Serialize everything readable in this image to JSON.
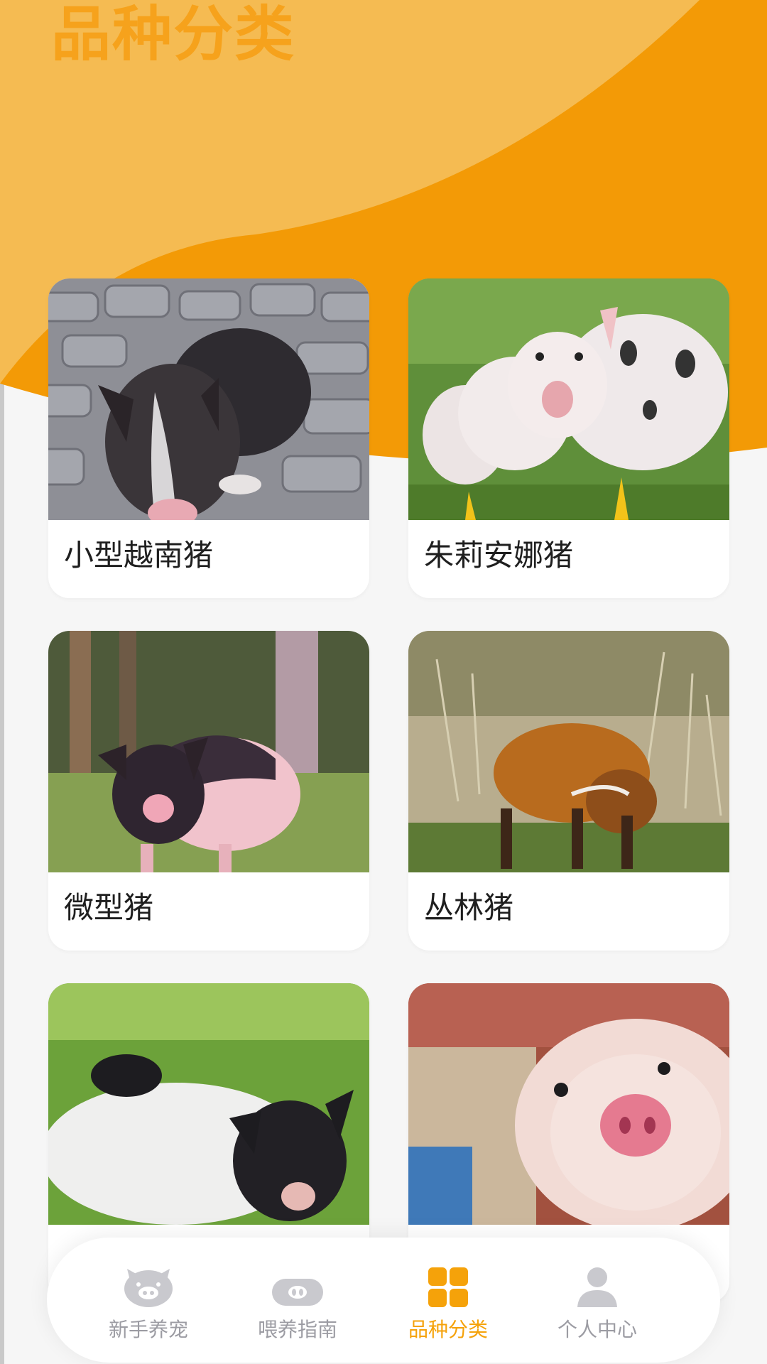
{
  "page": {
    "title": "品种分类"
  },
  "colors": {
    "header_orange": "#f39a06",
    "header_light": "#f5bb52",
    "title_color": "#f6a21c",
    "tab_active": "#f5a20a",
    "tab_inactive": "#9c9ca3",
    "background": "#f6f6f6"
  },
  "breeds": [
    {
      "name": "小型越南猪",
      "image": "black-potbelly-pig-photo"
    },
    {
      "name": "朱莉安娜猪",
      "image": "spotted-juliana-pigs-photo"
    },
    {
      "name": "微型猪",
      "image": "black-pink-micro-pig-photo"
    },
    {
      "name": "丛林猪",
      "image": "red-river-hog-photo"
    },
    {
      "name": "",
      "image": "black-white-piglet-photo"
    },
    {
      "name": "",
      "image": "pink-piglet-closeup-photo"
    }
  ],
  "tabbar": {
    "tabs": [
      {
        "label": "新手养宠",
        "icon": "pig-face-icon",
        "active": false
      },
      {
        "label": "喂养指南",
        "icon": "pig-snout-icon",
        "active": false
      },
      {
        "label": "品种分类",
        "icon": "grid-icon",
        "active": true
      },
      {
        "label": "个人中心",
        "icon": "person-icon",
        "active": false
      }
    ]
  }
}
